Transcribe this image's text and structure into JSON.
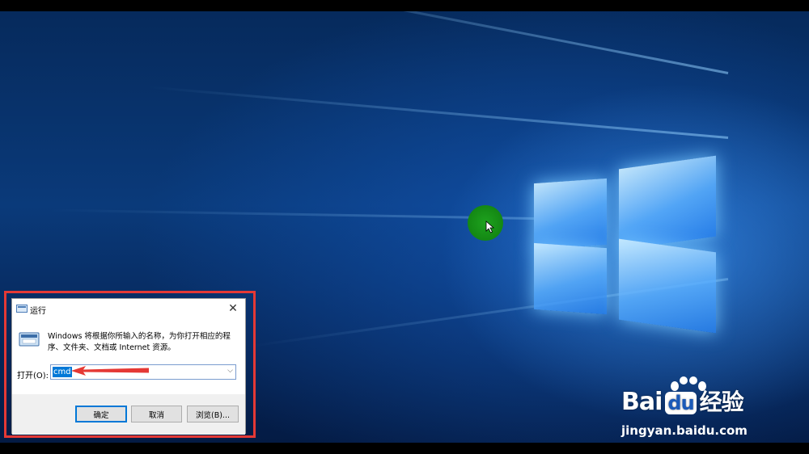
{
  "desktop": {
    "accent": "#0a3a7a"
  },
  "run_dialog": {
    "title": "运行",
    "close_glyph": "✕",
    "description": "Windows 将根据你所输入的名称，为你打开相应的程序、文件夹、文档或 Internet 资源。",
    "open_label": "打开(O):",
    "open_value": "cmd",
    "buttons": {
      "ok": "确定",
      "cancel": "取消",
      "browse": "浏览(B)..."
    },
    "highlight_color": "#e53935"
  },
  "watermark": {
    "brand_prefix": "Bai",
    "brand_suffix": "du",
    "brand_cn": "经验",
    "url": "jingyan.baidu.com"
  }
}
